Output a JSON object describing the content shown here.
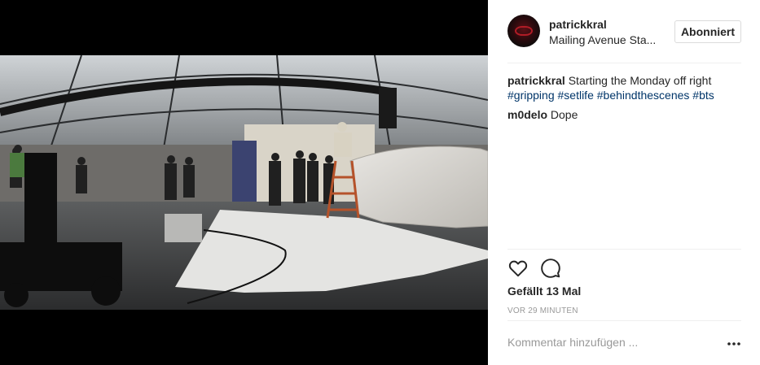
{
  "post": {
    "username": "patrickkral",
    "location": "Mailing Avenue Sta...",
    "follow_label": "Abonniert",
    "caption": {
      "author": "patrickkral",
      "text": "Starting the Monday off right",
      "hashtags": [
        "#gripping",
        "#setlife",
        "#behindthescenes",
        "#bts"
      ]
    },
    "comments": [
      {
        "author": "m0delo",
        "text": "Dope"
      }
    ],
    "likes_label": "Gefällt 13 Mal",
    "time_label": "VOR 29 MINUTEN",
    "comment_placeholder": "Kommentar hinzufügen ..."
  },
  "icons": {
    "like": "heart-icon",
    "comment": "speech-bubble-icon",
    "more": "more-options-icon"
  }
}
